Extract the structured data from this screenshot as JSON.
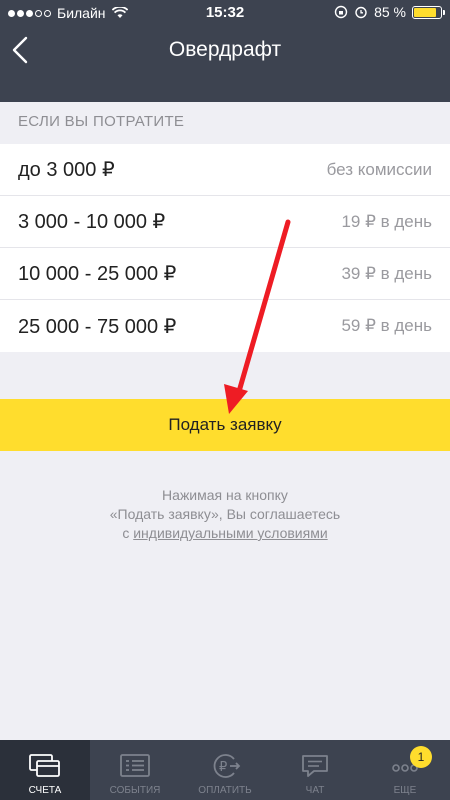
{
  "status_bar": {
    "carrier": "Билайн",
    "time": "15:32",
    "battery": "85 %",
    "battery_level": 0.85
  },
  "nav": {
    "title": "Овердрафт"
  },
  "section_header": "ЕСЛИ ВЫ ПОТРАТИТЕ",
  "tariffs": [
    {
      "range": "до 3 000 ₽",
      "fee": "без комиссии"
    },
    {
      "range": "3 000 - 10 000 ₽",
      "fee": "19 ₽ в день"
    },
    {
      "range": "10 000 - 25 000 ₽",
      "fee": "39 ₽ в день"
    },
    {
      "range": "25 000 - 75 000 ₽",
      "fee": "59 ₽ в день"
    }
  ],
  "apply_button": "Подать заявку",
  "note": {
    "line1": "Нажимая на кнопку",
    "line2": "«Подать заявку», Вы соглашаетесь",
    "prefix": "с ",
    "link": "индивидуальными условиями"
  },
  "tabs": [
    {
      "label": "СЧЕТА",
      "icon": "accounts-icon",
      "active": true
    },
    {
      "label": "СОБЫТИЯ",
      "icon": "events-icon"
    },
    {
      "label": "ОПЛАТИТЬ",
      "icon": "pay-icon"
    },
    {
      "label": "ЧАТ",
      "icon": "chat-icon"
    },
    {
      "label": "ЕЩЕ",
      "icon": "more-icon",
      "badge": "1"
    }
  ],
  "colors": {
    "header": "#3d4350",
    "accent": "#ffdd2d",
    "annotation_arrow": "#ee1c24"
  }
}
